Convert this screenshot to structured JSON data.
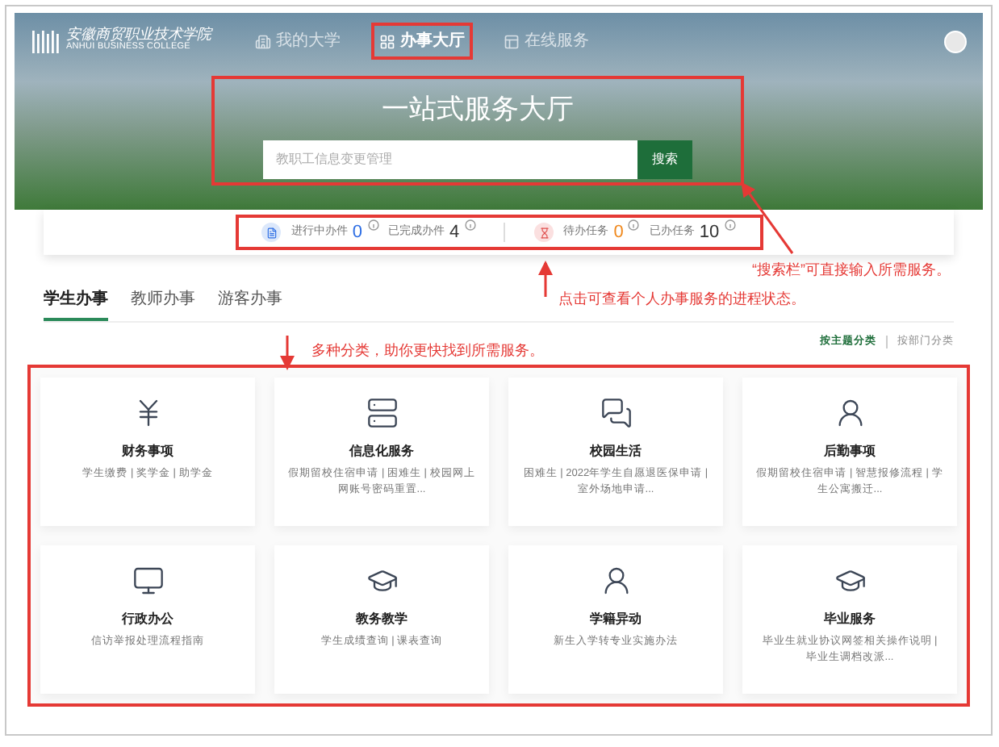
{
  "header": {
    "logo_text": "安徽商贸职业技术学院",
    "logo_subtitle": "ANHUI BUSINESS COLLEGE",
    "nav": [
      {
        "label": "我的大学",
        "selected": false,
        "kind": "building"
      },
      {
        "label": "办事大厅",
        "selected": true,
        "kind": "hall"
      },
      {
        "label": "在线服务",
        "selected": false,
        "kind": "panel"
      }
    ]
  },
  "banner": {
    "title": "一站式服务大厅",
    "search": {
      "placeholder": "教职工信息变更管理",
      "button": "搜索"
    }
  },
  "stats": [
    {
      "kind": "doc",
      "items": [
        {
          "label": "进行中办件",
          "value": "0",
          "color": "#2f6fe4"
        },
        {
          "label": "已完成办件",
          "value": "4",
          "color": "#333333"
        }
      ]
    },
    {
      "kind": "hourglass",
      "items": [
        {
          "label": "待办任务",
          "value": "0",
          "color": "#f0891e"
        },
        {
          "label": "已办任务",
          "value": "10",
          "color": "#333333"
        }
      ]
    }
  ],
  "tabs": [
    {
      "label": "学生办事",
      "selected": true
    },
    {
      "label": "教师办事",
      "selected": false
    },
    {
      "label": "游客办事",
      "selected": false
    }
  ],
  "sort_links": [
    {
      "label": "按主题分类",
      "selected": true
    },
    {
      "label": "按部门分类",
      "selected": false
    }
  ],
  "categories": [
    {
      "kind": "yen",
      "title": "财务事项",
      "description": "学生缴费 | 奖学金 | 助学金"
    },
    {
      "kind": "server",
      "title": "信息化服务",
      "description": "假期留校住宿申请 | 困难生 | 校园网上网账号密码重置..."
    },
    {
      "kind": "chat",
      "title": "校园生活",
      "description": "困难生 | 2022年学生自愿退医保申请 | 室外场地申请..."
    },
    {
      "kind": "person",
      "title": "后勤事项",
      "description": "假期留校住宿申请 | 智慧报修流程 | 学生公寓搬迁..."
    },
    {
      "kind": "monitor",
      "title": "行政办公",
      "description": "信访举报处理流程指南"
    },
    {
      "kind": "cap",
      "title": "教务教学",
      "description": "学生成绩查询 | 课表查询"
    },
    {
      "kind": "person",
      "title": "学籍异动",
      "description": "新生入学转专业实施办法"
    },
    {
      "kind": "cap",
      "title": "毕业服务",
      "description": "毕业生就业协议网签相关操作说明 | 毕业生调档改派..."
    }
  ],
  "annotations": [
    {
      "text": "“搜索栏”可直接输入所需服务。"
    },
    {
      "text": "点击可查看个人办事服务的进程状态。"
    },
    {
      "text": "多种分类，助你更快找到所需服务。"
    }
  ]
}
